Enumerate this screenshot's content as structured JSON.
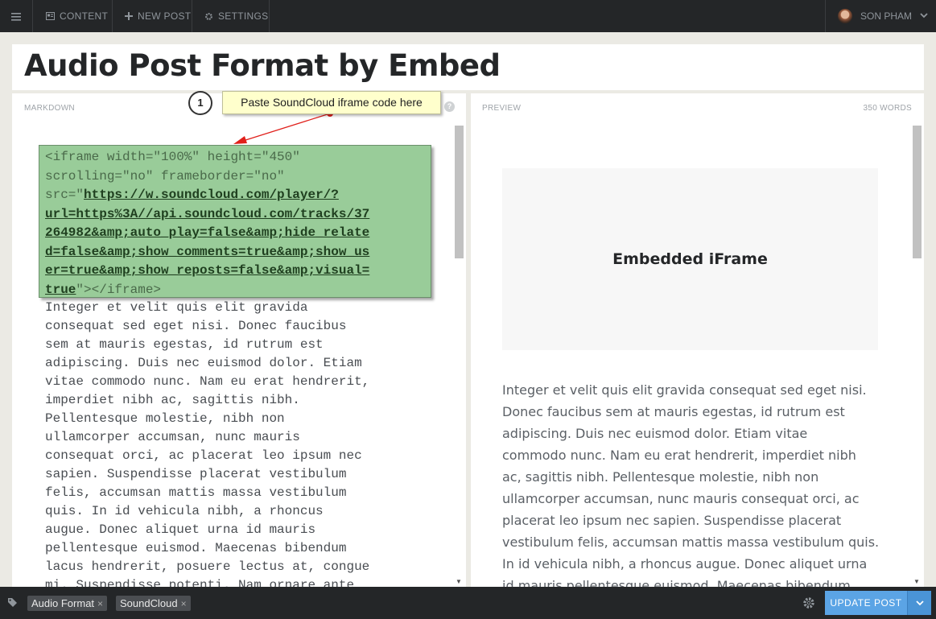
{
  "nav": {
    "content_label": "CONTENT",
    "new_post_label": "NEW POST",
    "settings_label": "SETTINGS",
    "user_name": "SON PHAM"
  },
  "post": {
    "title": "Audio Post Format by Embed"
  },
  "editor": {
    "label": "MARKDOWN",
    "help": "?",
    "code_lines": [
      "<iframe width=\"100%\" height=\"450\"",
      "scrolling=\"no\" frameborder=\"no\"",
      "src=\"",
      "https://w.soundcloud.com/player/?",
      "url=https%3A//api.soundcloud.com/tracks/37",
      "264982&amp;auto_play=false&amp;hide_relate",
      "d=false&amp;show_comments=true&amp;show_us",
      "er=true&amp;show_reposts=false&amp;visual=",
      "true",
      "\"></iframe>"
    ],
    "body_text": "Integer et velit quis elit gravida\nconsequat sed eget nisi. Donec faucibus\nsem at mauris egestas, id rutrum est\nadipiscing. Duis nec euismod dolor. Etiam\nvitae commodo nunc. Nam eu erat hendrerit,\nimperdiet nibh ac, sagittis nibh.\nPellentesque molestie, nibh non\nullamcorper accumsan, nunc mauris\nconsequat orci, ac placerat leo ipsum nec\nsapien. Suspendisse placerat vestibulum\nfelis, accumsan mattis massa vestibulum\nquis. In id vehicula nibh, a rhoncus\naugue. Donec aliquet urna id mauris\npellentesque euismod. Maecenas bibendum\nlacus hendrerit, posuere lectus at, congue\nmi. Suspendisse potenti. Nam ornare ante"
  },
  "annotation": {
    "number": "1",
    "text": "Paste SoundCloud iframe code here"
  },
  "preview": {
    "label": "PREVIEW",
    "word_count": "350 WORDS",
    "embed_placeholder": "Embedded iFrame",
    "body_text": "Integer et velit quis elit gravida consequat sed eget nisi.\nDonec faucibus sem at mauris egestas, id rutrum est\nadipiscing. Duis nec euismod dolor. Etiam vitae\ncommodo nunc. Nam eu erat hendrerit, imperdiet nibh\nac, sagittis nibh. Pellentesque molestie, nibh non\nullamcorper accumsan, nunc mauris consequat orci, ac\nplacerat leo ipsum nec sapien. Suspendisse placerat\nvestibulum felis, accumsan mattis massa vestibulum quis.\nIn id vehicula nibh, a rhoncus augue. Donec aliquet urna\nid mauris pellentesque euismod. Maecenas bibendum"
  },
  "footer": {
    "tags": [
      "Audio Format",
      "SoundCloud"
    ],
    "tag_remove": "×",
    "update_label": "UPDATE POST"
  },
  "colors": {
    "topbar": "#242628",
    "accent": "#5ba4e5",
    "code_highlight": "#99cc99",
    "callout": "#ffffcc",
    "arrow": "#e0201b"
  }
}
